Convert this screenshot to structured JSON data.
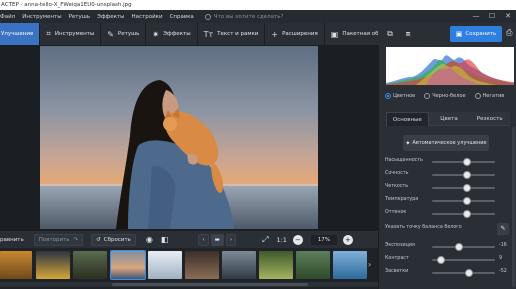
{
  "window": {
    "title": "АСТЕР - anna-tello-X_FWeiqa1EU0-unsplash.jpg",
    "controls": {
      "minimize": "—",
      "maximize": "☐",
      "close": "✕"
    }
  },
  "menu": {
    "items": [
      "Файл",
      "Инструменты",
      "Ретушь",
      "Эффекты",
      "Настройки",
      "Справка"
    ],
    "search_placeholder": "Что вы хотите сделать?"
  },
  "toolbar": {
    "tools": [
      {
        "label": "Улучшение",
        "icon": "enhance-icon",
        "glyph": "",
        "active": true
      },
      {
        "label": "Инструменты",
        "icon": "crop-icon",
        "glyph": "⌗",
        "active": false
      },
      {
        "label": "Ретушь",
        "icon": "brush-icon",
        "glyph": "✎",
        "active": false
      },
      {
        "label": "Эффекты",
        "icon": "sparkle-icon",
        "glyph": "✷",
        "active": false
      },
      {
        "label": "Текст и рамки",
        "icon": "text-icon",
        "glyph": "Tт",
        "active": false
      },
      {
        "label": "Расширения",
        "icon": "plus-icon",
        "glyph": "+",
        "active": false
      },
      {
        "label": "Пакетная обработка",
        "icon": "batch-icon",
        "glyph": "▣",
        "active": false
      }
    ],
    "save_label": "Сохранить"
  },
  "bottom": {
    "compare_label": "равнить",
    "redo_label": "Повторить",
    "reset_label": "Сбросить",
    "ratio_label": "1:1",
    "zoom_value": "17%",
    "zoom_minus": "−",
    "zoom_plus": "+"
  },
  "panel": {
    "modes": [
      {
        "label": "Цветное",
        "selected": true
      },
      {
        "label": "Черно-белое",
        "selected": false
      },
      {
        "label": "Негатив",
        "selected": false
      }
    ],
    "tabs": [
      {
        "label": "Основные",
        "active": true
      },
      {
        "label": "Цвета",
        "active": false
      },
      {
        "label": "Резкость",
        "active": false
      }
    ],
    "auto_label": "Автоматическое улучшение",
    "sliders_top": [
      {
        "label": "Насыщенность",
        "position": 0.56,
        "value": ""
      },
      {
        "label": "Сочность",
        "position": 0.56,
        "value": ""
      },
      {
        "label": "Четкость",
        "position": 0.56,
        "value": ""
      },
      {
        "label": "Температура",
        "position": 0.56,
        "value": ""
      },
      {
        "label": "Оттенок",
        "position": 0.56,
        "value": ""
      }
    ],
    "white_balance_label": "Указать точку баланса белого",
    "sliders_bottom": [
      {
        "label": "Экспозиция",
        "position": 0.43,
        "value": "-16"
      },
      {
        "label": "Контраст",
        "position": 0.15,
        "value": "9"
      },
      {
        "label": "Засветки",
        "position": 0.58,
        "value": "-52"
      }
    ]
  },
  "colors": {
    "accent": "#2e7fe0",
    "active_tool": "#3a73c4",
    "panel_bg": "#2a2e35"
  }
}
